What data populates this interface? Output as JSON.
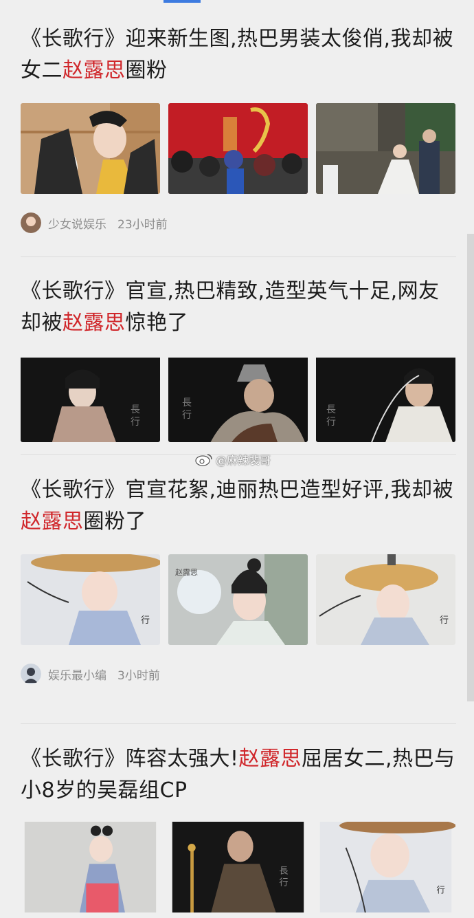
{
  "articles": [
    {
      "title_parts": [
        "《长歌行》迎来新生图,热巴男装太俊俏,我却被女二",
        "赵露思",
        "圈粉"
      ],
      "thumbnail_subjects": [
        "actress-costume-photo",
        "film-set-crowd-red-backdrop",
        "outdoor-film-set"
      ],
      "source": "少女说娱乐",
      "time": "23小时前"
    },
    {
      "title_parts": [
        "《长歌行》官宣,热巴精致,造型英气十足,网友却被",
        "赵露思",
        "惊艳了"
      ],
      "thumbnail_subjects": [
        "poster-actress-dark",
        "poster-armored-actor-dark",
        "poster-actor-white-robe-dark"
      ]
    },
    {
      "title_parts": [
        "《长歌行》官宣花絮,迪丽热巴造型好评,我却被",
        "赵露思",
        "圈粉了"
      ],
      "thumbnail_subjects": [
        "actress-straw-hat",
        "character-poster-actress",
        "actress-straw-hat-veil"
      ],
      "source": "娱乐最小编",
      "time": "3小时前"
    },
    {
      "title_parts": [
        "《长歌行》阵容太强大!",
        "赵露思",
        "屈居女二,热巴与小8岁的吴磊组CP"
      ],
      "thumbnail_subjects": [
        "actress-pink-hanfu",
        "poster-dark-warrior",
        "actress-straw-hat-closeup"
      ]
    }
  ],
  "watermark": "@麻辣裴哥",
  "colors": {
    "highlight": "#d0272b",
    "accent": "#3d7be0",
    "meta": "#8c8c8c"
  }
}
